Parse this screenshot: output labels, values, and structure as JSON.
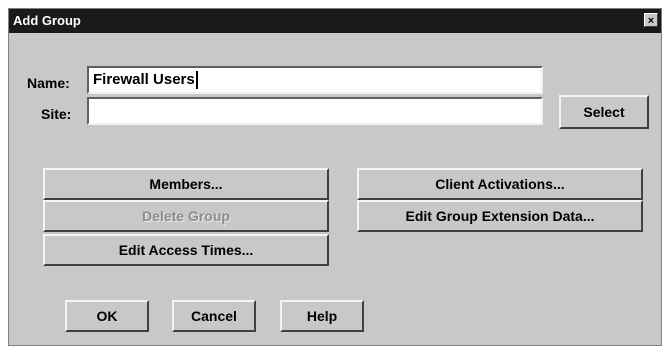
{
  "window": {
    "title": "Add Group",
    "close_label": "×"
  },
  "form": {
    "name_label": "Name:",
    "name_value": "Firewall Users",
    "site_label": "Site:",
    "site_value": "",
    "select_label": "Select"
  },
  "actions": {
    "members": "Members...",
    "delete_group": "Delete Group",
    "edit_access_times": "Edit Access Times...",
    "client_activations": "Client Activations...",
    "edit_group_extension_data": "Edit Group Extension Data..."
  },
  "footer": {
    "ok": "OK",
    "cancel": "Cancel",
    "help": "Help"
  }
}
